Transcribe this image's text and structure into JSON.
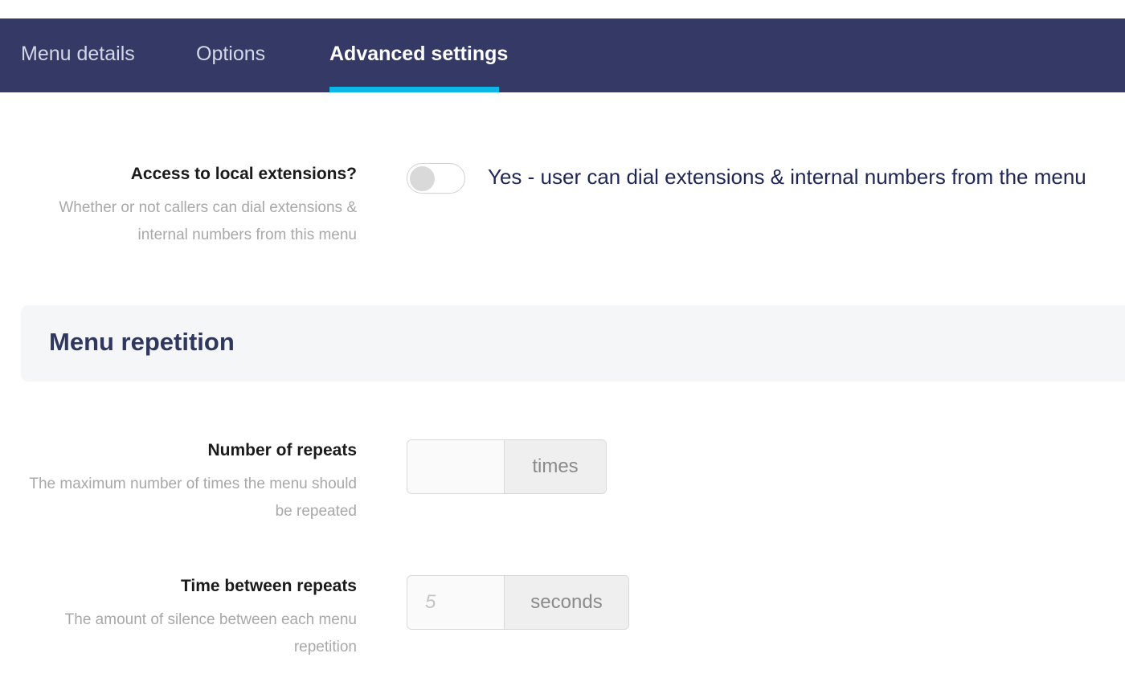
{
  "tabs": [
    {
      "label": "Menu details",
      "active": false
    },
    {
      "label": "Options",
      "active": false
    },
    {
      "label": "Advanced settings",
      "active": true
    }
  ],
  "colors": {
    "tabbar_bg": "#343a65",
    "tab_active_underline": "#0bb7e6",
    "section_bg": "#f5f6f8",
    "section_title": "#30375f"
  },
  "local_extensions": {
    "label": "Access to local extensions?",
    "help": "Whether or not callers can dial extensions & internal numbers from this menu",
    "toggle_on": false,
    "toggle_text": "Yes - user can dial extensions & internal numbers from the menu"
  },
  "menu_repetition": {
    "title": "Menu repetition",
    "number_of_repeats": {
      "label": "Number of repeats",
      "help": "The maximum number of times the menu should be repeated",
      "value": "",
      "placeholder": "",
      "unit": "times"
    },
    "time_between_repeats": {
      "label": "Time between repeats",
      "help": "The amount of silence between each menu repetition",
      "value": "",
      "placeholder": "5",
      "unit": "seconds"
    }
  }
}
